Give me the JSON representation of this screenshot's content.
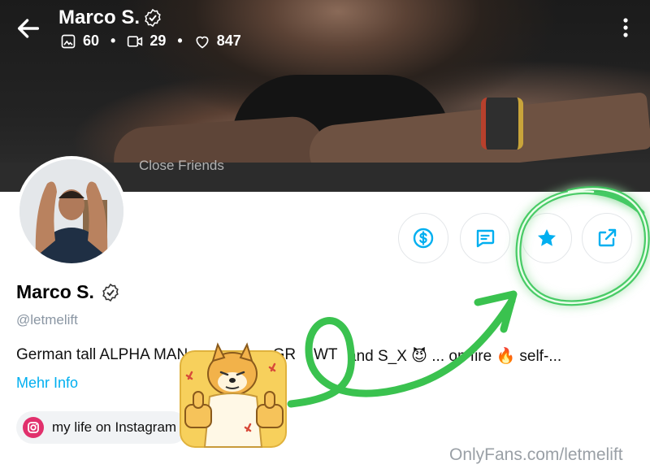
{
  "header": {
    "title": "Marco S.",
    "stats": {
      "photos": "60",
      "videos": "29",
      "likes": "847"
    },
    "cover_caption": "Close Friends"
  },
  "profile": {
    "name": "Marco S.",
    "handle": "@letmelift",
    "bio": "German tall ALPHA MAN",
    "bio_tail_1": "r GR",
    "bio_tail_2": "WT",
    "bio_tail_3": "and S_X 😈 ... on fire 🔥 self-...",
    "more_info": "Mehr Info",
    "link_label": "my life on Instagram"
  },
  "actions": {
    "tip_icon": "dollar-icon",
    "message_icon": "message-icon",
    "favorite_icon": "star-icon",
    "share_icon": "share-icon"
  },
  "watermark": "OnlyFans.com/letmelift",
  "colors": {
    "accent": "#00aff0",
    "highlight": "#35c759",
    "instagram": "#e1306c"
  }
}
